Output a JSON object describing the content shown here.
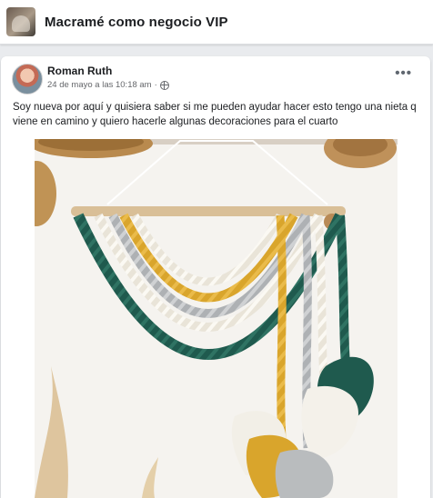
{
  "group": {
    "name": "Macramé como negocio VIP",
    "thumb_icon": "group-cover-thumbnail"
  },
  "post": {
    "author": "Roman Ruth",
    "timestamp": "24 de mayo a las 10:18 am",
    "meta_separator": "·",
    "privacy_icon": "globe-icon",
    "more_icon": "•••",
    "text": "Soy nueva por aquí y quisiera saber si me pueden ayudar hacer esto tengo una nieta q viene en camino y quiero hacerle algunas decoraciones para el cuarto",
    "image_alt": "macrame wall hanging with dowel"
  },
  "colors": {
    "teal": "#1f5a4e",
    "mustard": "#d9a52c",
    "grey": "#b9bcbe",
    "cream": "#f2efe7",
    "wall": "#f5f3ef",
    "dowel": "#d9bf97"
  }
}
